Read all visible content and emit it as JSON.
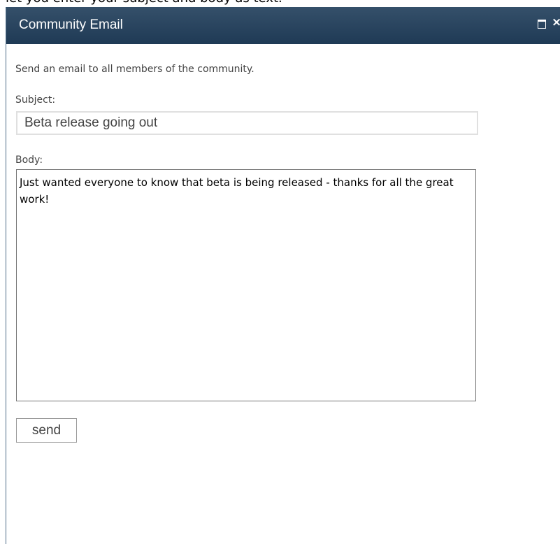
{
  "page_top_text": "let you enter your subject and body as text.",
  "dialog": {
    "title": "Community Email",
    "maximize_icon": "maximize-icon",
    "close_symbol": "×",
    "title_bar_color": "#2a4560",
    "border_color": "#4f6d88"
  },
  "form": {
    "description": "Send an email to all members of the community.",
    "subject_label": "Subject:",
    "subject_value": "Beta release going out",
    "body_label": "Body:",
    "body_value": "Just wanted everyone to know that beta is being released - thanks for all the great work!",
    "send_label": "send"
  }
}
